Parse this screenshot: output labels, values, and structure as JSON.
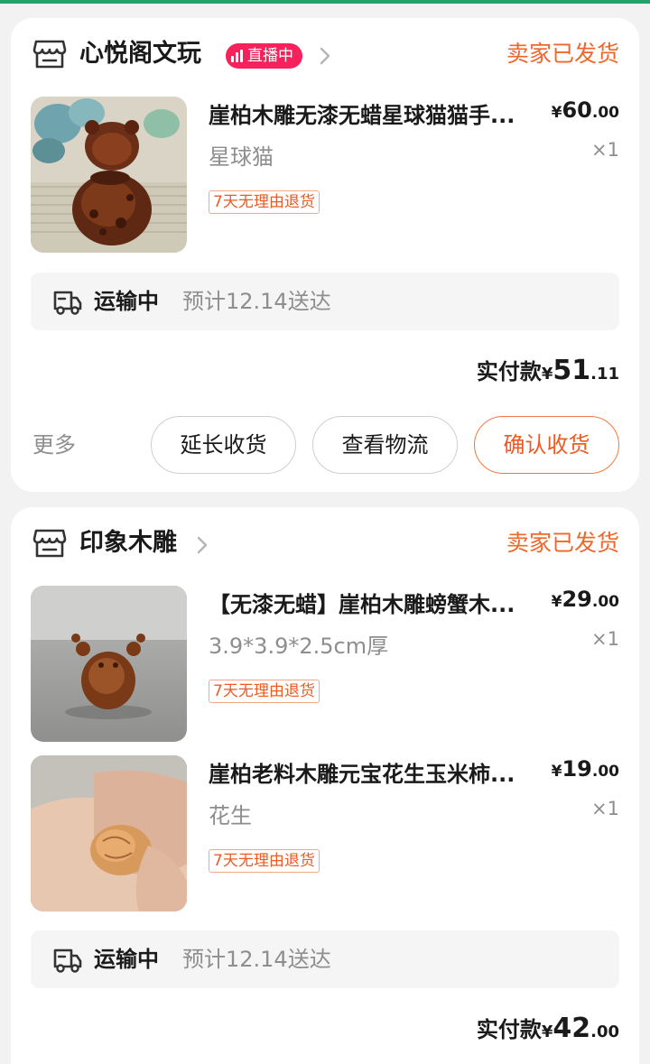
{
  "orders": [
    {
      "shop_name": "心悦阁文玩",
      "live_badge": "直播中",
      "status": "卖家已发货",
      "items": [
        {
          "title": "崖柏木雕无漆无蜡星球猫猫手...",
          "spec": "星球猫",
          "tag": "7天无理由退货",
          "price_currency": "¥",
          "price_int": "60",
          "price_dec": ".00",
          "qty": "×1"
        }
      ],
      "shipping": {
        "status": "运输中",
        "eta": "预计12.14送达"
      },
      "paid": {
        "label": "实付款",
        "currency": "¥",
        "int": "51",
        "dec": ".11"
      },
      "more": "更多",
      "buttons": {
        "extend": "延长收货",
        "logistics": "查看物流",
        "confirm": "确认收货"
      }
    },
    {
      "shop_name": "印象木雕",
      "status": "卖家已发货",
      "items": [
        {
          "title": "【无漆无蜡】崖柏木雕螃蟹木...",
          "spec": "3.9*3.9*2.5cm厚",
          "tag": "7天无理由退货",
          "price_currency": "¥",
          "price_int": "29",
          "price_dec": ".00",
          "qty": "×1"
        },
        {
          "title": "崖柏老料木雕元宝花生玉米柿...",
          "spec": "花生",
          "tag": "7天无理由退货",
          "price_currency": "¥",
          "price_int": "19",
          "price_dec": ".00",
          "qty": "×1"
        }
      ],
      "shipping": {
        "status": "运输中",
        "eta": "预计12.14送达"
      },
      "paid": {
        "label": "实付款",
        "currency": "¥",
        "int": "42",
        "dec": ".00"
      }
    }
  ],
  "colors": {
    "accent": "#f0672b",
    "live": "#f7215c",
    "top_bar": "#21a36b"
  },
  "icons": [
    "shop-icon",
    "chevron-right-icon",
    "truck-icon",
    "live-bars-icon"
  ]
}
